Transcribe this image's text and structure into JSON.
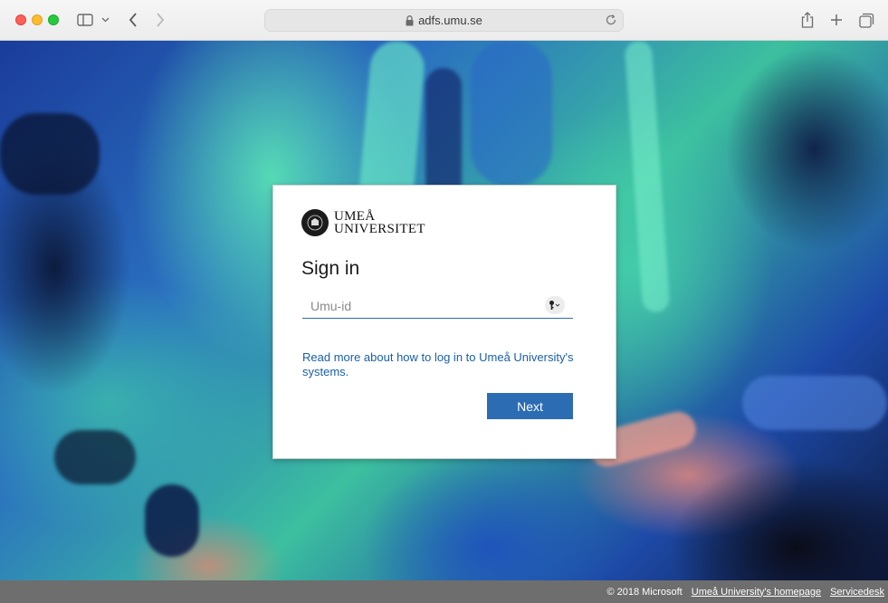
{
  "browser": {
    "url": "adfs.umu.se"
  },
  "card": {
    "logo_line1": "UMEÅ",
    "logo_line2": "UNIVERSITET",
    "title": "Sign in",
    "username_placeholder": "Umu-id",
    "username_value": "",
    "help_link": "Read more about how to log in to Umeå University's systems.",
    "next_label": "Next"
  },
  "footer": {
    "copyright": "© 2018 Microsoft",
    "homepage_link": "Umeå University's homepage",
    "servicedesk_link": "Servicedesk"
  },
  "colors": {
    "accent": "#2b6cb3",
    "link": "#1a5fa8",
    "footer_bg": "#6e6e6e"
  },
  "icons": [
    "sidebar-icon",
    "chevron-down-icon",
    "back-icon",
    "forward-icon",
    "lock-icon",
    "reload-icon",
    "share-icon",
    "plus-icon",
    "tabs-icon",
    "key-icon",
    "seal-icon"
  ]
}
